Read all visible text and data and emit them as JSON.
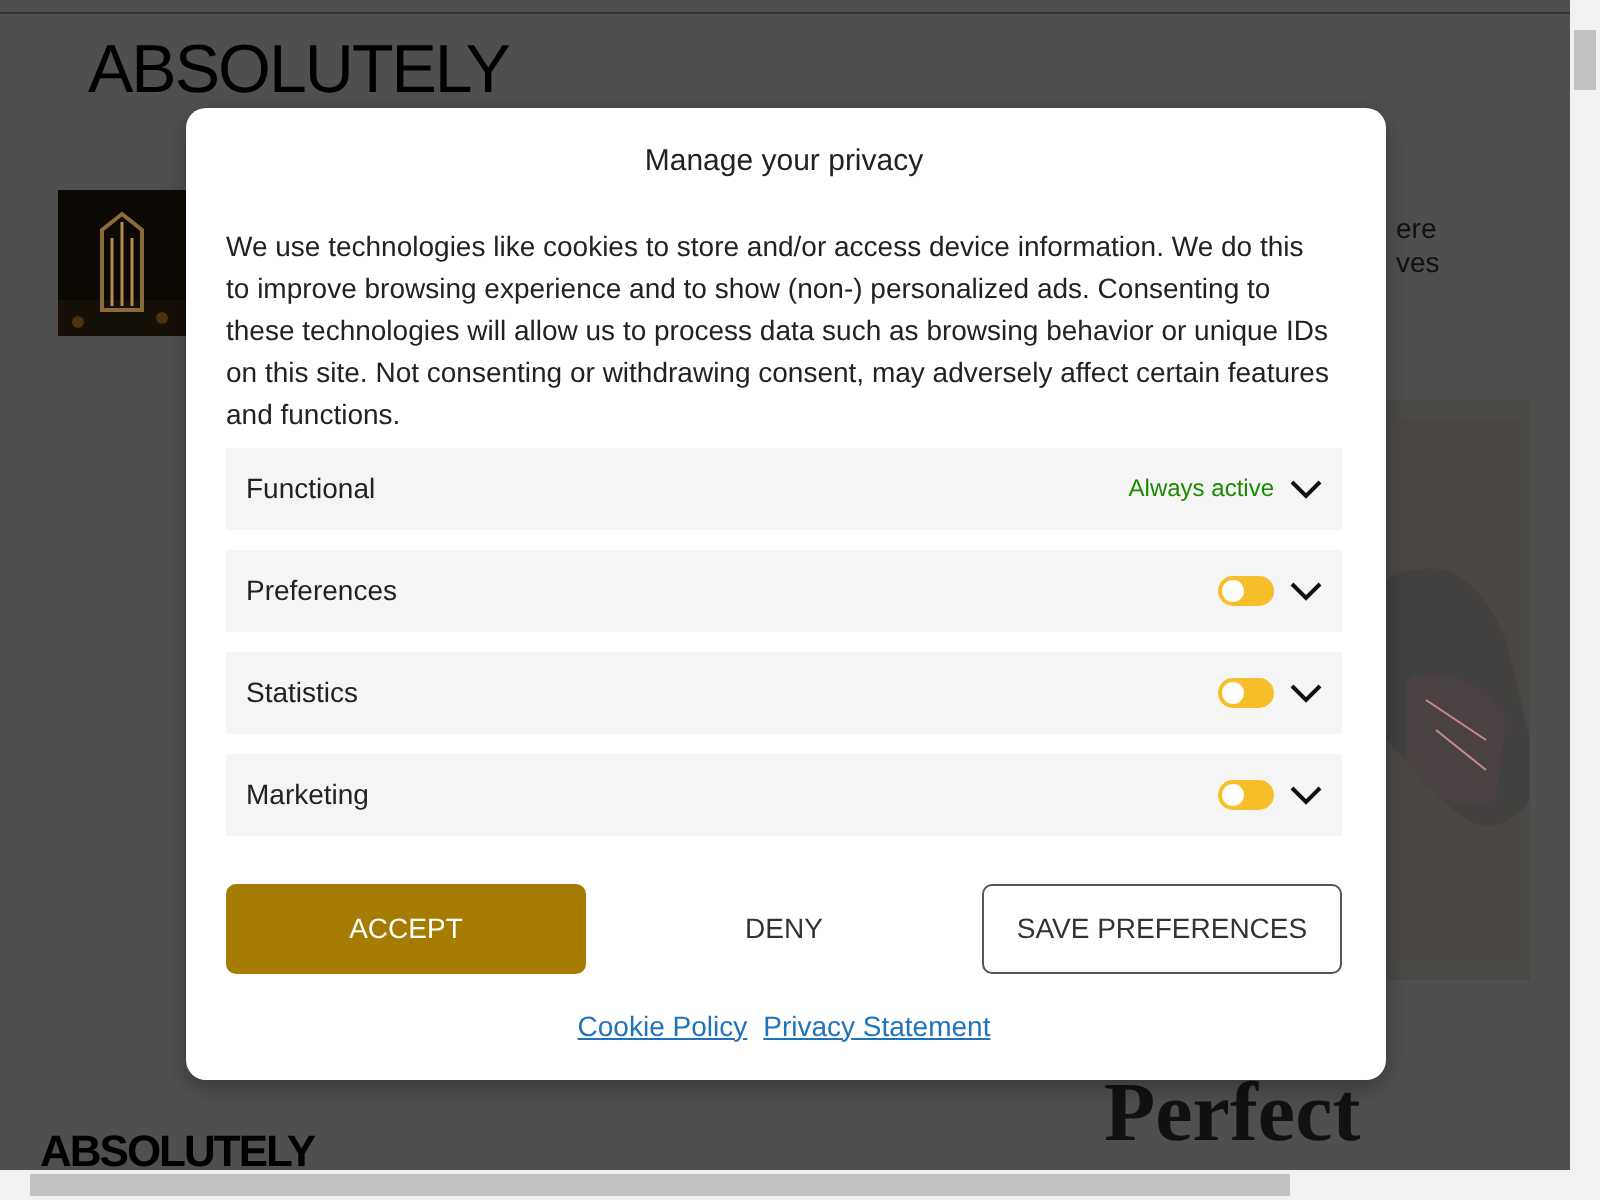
{
  "background_page": {
    "logo": "ABSOLUTELY",
    "teaser_lines": [
      "ere",
      "ves"
    ],
    "headline": "Perfect",
    "footer_logo": "ABSOLUTELY"
  },
  "dialog": {
    "title": "Manage your privacy",
    "text": "We use technologies like cookies to store and/or access device information. We do this to improve browsing experience and to show (non-) personalized ads. Consenting to these technologies will allow us to process data such as browsing behavior or unique IDs on this site. Not consenting or withdrawing consent, may adversely affect certain features and functions.",
    "categories": [
      {
        "label": "Functional",
        "kind": "status",
        "status": "Always active",
        "expanded": false
      },
      {
        "label": "Preferences",
        "kind": "toggle",
        "on": false,
        "expanded": false
      },
      {
        "label": "Statistics",
        "kind": "toggle",
        "on": false,
        "expanded": false
      },
      {
        "label": "Marketing",
        "kind": "toggle",
        "on": false,
        "expanded": false
      }
    ],
    "buttons": [
      {
        "label": "ACCEPT",
        "kind": "primary"
      },
      {
        "label": "DENY",
        "kind": "plain"
      },
      {
        "label": "SAVE PREFERENCES",
        "kind": "outline"
      }
    ],
    "links": [
      "Cookie Policy",
      "Privacy Statement"
    ]
  }
}
